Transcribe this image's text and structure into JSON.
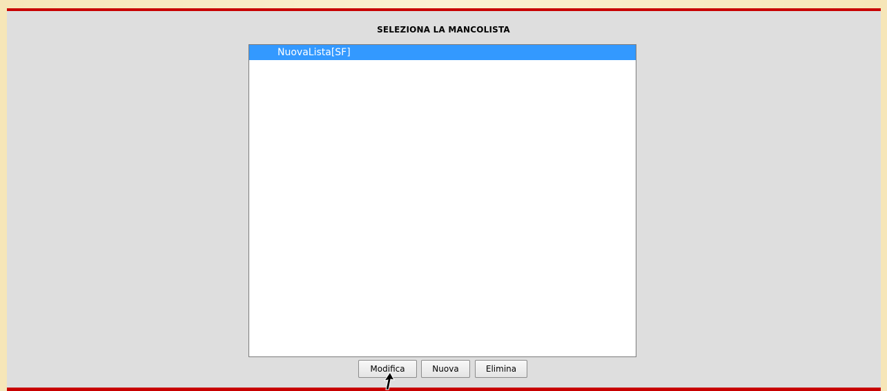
{
  "title": "SELEZIONA LA MANCOLISTA",
  "list": {
    "items": [
      {
        "label": "NuovaLista[SF]",
        "selected": true
      }
    ]
  },
  "buttons": {
    "modifica": "Modifica",
    "nuova": "Nuova",
    "elimina": "Elimina"
  },
  "colors": {
    "accent_rule": "#c80000",
    "selection": "#3399ff",
    "panel": "#dedede"
  },
  "icons": {
    "cursor": "mouse-pointer-icon"
  }
}
